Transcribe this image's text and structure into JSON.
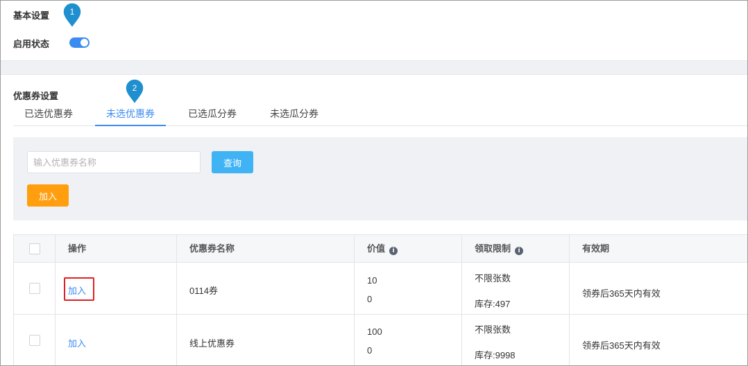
{
  "basic": {
    "title": "基本设置",
    "enable_label": "启用状态"
  },
  "coupon_settings": {
    "title": "优惠券设置",
    "tabs": [
      "已选优惠券",
      "未选优惠券",
      "已选瓜分券",
      "未选瓜分券"
    ],
    "active_tab": "未选优惠券"
  },
  "filter": {
    "search_placeholder": "输入优惠券名称",
    "query_label": "查询",
    "add_label": "加入"
  },
  "table": {
    "columns": [
      "操作",
      "优惠券名称",
      "价值",
      "领取限制",
      "有效期"
    ],
    "rows": [
      {
        "action": "加入",
        "name": "0114券",
        "value_line1": "10",
        "value_line2": "0",
        "limit": "不限张数",
        "stock": "库存:497",
        "validity": "领券后365天内有效"
      },
      {
        "action": "加入",
        "name": "线上优惠券",
        "value_line1": "100",
        "value_line2": "0",
        "limit": "不限张数",
        "stock": "库存:9998",
        "validity": "领券后365天内有效"
      }
    ]
  },
  "markers": {
    "m1": "1",
    "m2": "2"
  },
  "colors": {
    "accent": "#3b8cf1",
    "query": "#40b3f4",
    "add": "#ff9f0f",
    "marker": "#1f8fcf",
    "highlight": "#e02020"
  }
}
